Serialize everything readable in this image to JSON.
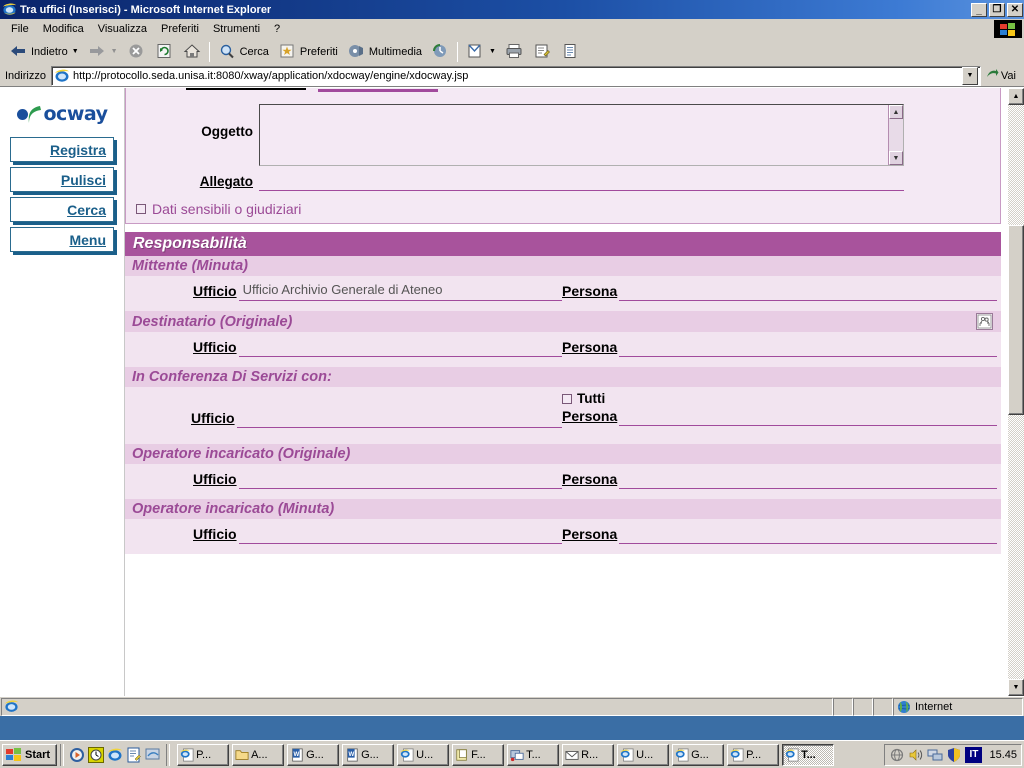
{
  "window": {
    "title": "Tra uffici (Inserisci) - Microsoft Internet Explorer",
    "minimize": "_",
    "restore": "❐",
    "close": "✕"
  },
  "menubar": {
    "items": [
      {
        "label": "File"
      },
      {
        "label": "Modifica"
      },
      {
        "label": "Visualizza"
      },
      {
        "label": "Preferiti"
      },
      {
        "label": "Strumenti"
      },
      {
        "label": "?"
      }
    ]
  },
  "toolbar": {
    "back": "Indietro",
    "forward": "",
    "stop": "",
    "refresh": "",
    "home": "",
    "search": "Cerca",
    "favorites": "Preferiti",
    "media": "Multimedia",
    "history": "",
    "mail": "",
    "print": "",
    "edit": "",
    "discuss": ""
  },
  "addressbar": {
    "label": "Indirizzo",
    "url": "http://protocollo.seda.unisa.it:8080/xway/application/xdocway/engine/xdocway.jsp",
    "go": "Vai"
  },
  "sidebar": {
    "logo_word": "ocway",
    "buttons": [
      {
        "label": "Registra"
      },
      {
        "label": "Pulisci"
      },
      {
        "label": "Cerca"
      },
      {
        "label": "Menu"
      }
    ]
  },
  "form": {
    "oggetto_label": "Oggetto",
    "oggetto_value": "",
    "allegato_label": "Allegato",
    "allegato_value": "",
    "sensitive_checkbox_label": "Dati sensibili o giudiziari",
    "sensitive_checked": false
  },
  "responsabilita": {
    "title": "Responsabilità",
    "sections": [
      {
        "title": "Mittente (Minuta)",
        "has_icon": false,
        "ufficio_label": "Ufficio",
        "ufficio_value": "Ufficio Archivio Generale di Ateneo",
        "persona_label": "Persona",
        "persona_value": ""
      },
      {
        "title": "Destinatario (Originale)",
        "has_icon": true,
        "ufficio_label": "Ufficio",
        "ufficio_value": "",
        "persona_label": "Persona",
        "persona_value": ""
      },
      {
        "title": "In Conferenza Di Servizi con:",
        "has_icon": false,
        "ufficio_label": "Ufficio",
        "ufficio_value": "",
        "persona_label": "Persona",
        "persona_value": "",
        "tutti_label": "Tutti",
        "tutti_checked": false
      },
      {
        "title": "Operatore incaricato (Originale)",
        "has_icon": false,
        "ufficio_label": "Ufficio",
        "ufficio_value": "",
        "persona_label": "Persona",
        "persona_value": ""
      },
      {
        "title": "Operatore incaricato (Minuta)",
        "has_icon": false,
        "ufficio_label": "Ufficio",
        "ufficio_value": "",
        "persona_label": "Persona",
        "persona_value": ""
      }
    ]
  },
  "statusbar": {
    "message": "",
    "zone": "Internet"
  },
  "taskbar": {
    "start": "Start",
    "tasks": [
      {
        "label": "P...",
        "icon": "ie-doc-icon",
        "active": false
      },
      {
        "label": "A...",
        "icon": "folder-icon",
        "active": false
      },
      {
        "label": "G...",
        "icon": "word-icon",
        "active": false
      },
      {
        "label": "G...",
        "icon": "word-icon",
        "active": false
      },
      {
        "label": "U...",
        "icon": "ie-doc-icon",
        "active": false
      },
      {
        "label": "F...",
        "icon": "note-icon",
        "active": false
      },
      {
        "label": "T...",
        "icon": "mailmerge-icon",
        "active": false
      },
      {
        "label": "R...",
        "icon": "envelope-icon",
        "active": false
      },
      {
        "label": "U...",
        "icon": "ie-doc-icon",
        "active": false
      },
      {
        "label": "G...",
        "icon": "ie-doc-icon",
        "active": false
      },
      {
        "label": "P...",
        "icon": "ie-doc-icon",
        "active": false
      },
      {
        "label": "T...",
        "icon": "ie-doc-icon",
        "active": true
      }
    ],
    "language": "IT",
    "clock": "15.45"
  },
  "colors": {
    "title_bar": "#0a246a",
    "header_bar": "#a8539c",
    "subheader_bar": "#e8cde4",
    "panel_bg": "#f4e9f4",
    "section_bg": "#f2e4f0",
    "accent_line": "#a14a9c",
    "label_purple": "#9b4a96",
    "nav_blue": "#1a5f8a",
    "logo_blue": "#1a4f9c",
    "logo_green": "#2e9b4f"
  }
}
